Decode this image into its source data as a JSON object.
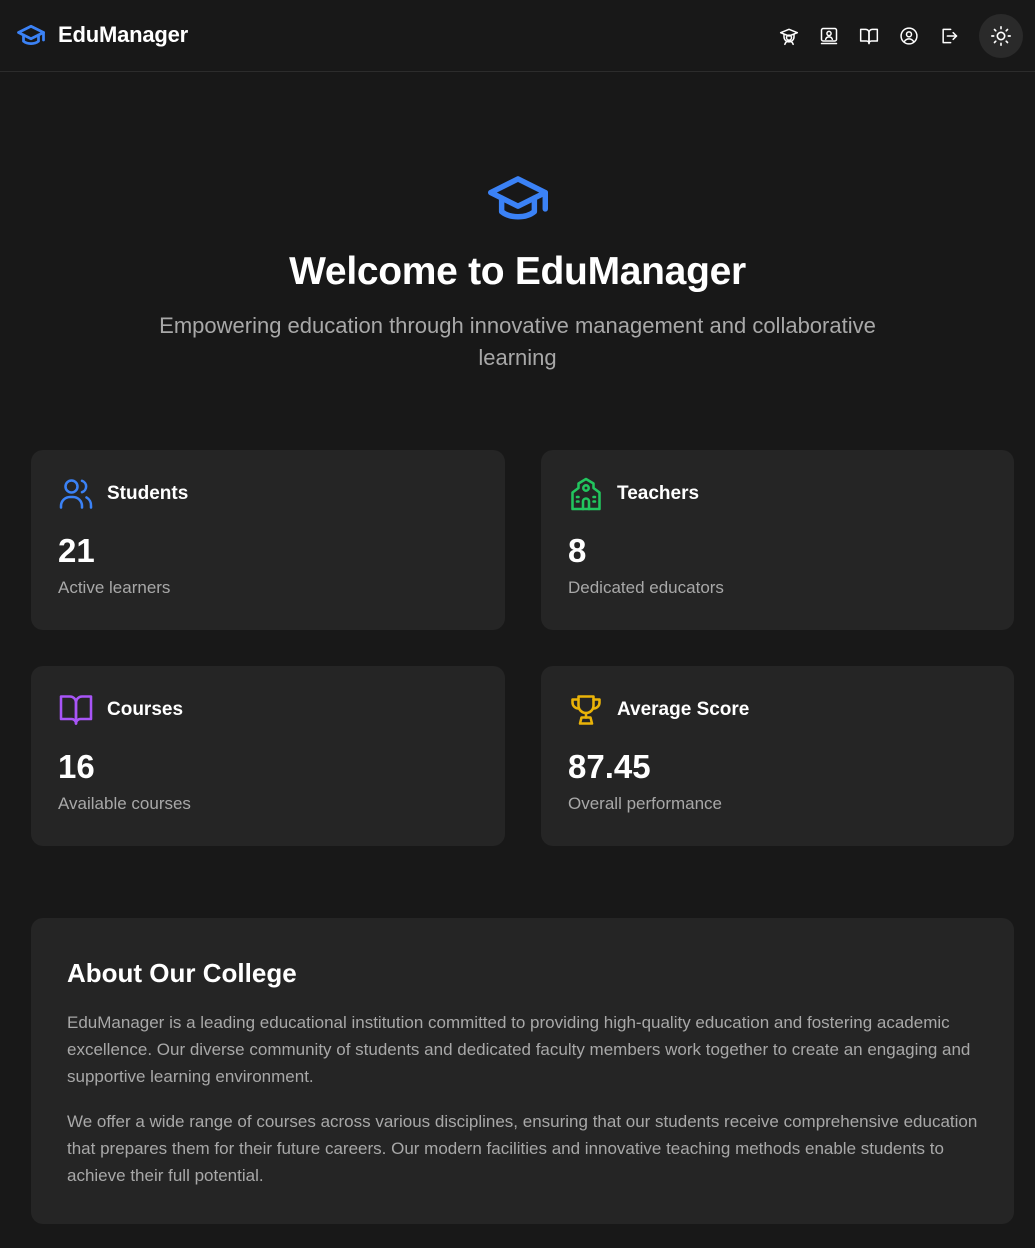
{
  "app": {
    "name": "EduManager"
  },
  "nav": {
    "icons": [
      "graduation-icon",
      "presentation-icon",
      "book-icon",
      "user-icon",
      "logout-icon",
      "sun-icon"
    ]
  },
  "hero": {
    "title": "Welcome to EduManager",
    "subtitle": "Empowering education through innovative management and collaborative learning"
  },
  "stats": [
    {
      "label": "Students",
      "value": "21",
      "desc": "Active learners",
      "icon": "users-icon",
      "color": "#3b82f6"
    },
    {
      "label": "Teachers",
      "value": "8",
      "desc": "Dedicated educators",
      "icon": "school-icon",
      "color": "#22c55e"
    },
    {
      "label": "Courses",
      "value": "16",
      "desc": "Available courses",
      "icon": "book-open-icon",
      "color": "#a855f7"
    },
    {
      "label": "Average Score",
      "value": "87.45",
      "desc": "Overall performance",
      "icon": "trophy-icon",
      "color": "#eab308"
    }
  ],
  "about": {
    "title": "About Our College",
    "paragraphs": [
      "EduManager is a leading educational institution committed to providing high-quality education and fostering academic excellence. Our diverse community of students and dedicated faculty members work together to create an engaging and supportive learning environment.",
      "We offer a wide range of courses across various disciplines, ensuring that our students receive comprehensive education that prepares them for their future careers. Our modern facilities and innovative teaching methods enable students to achieve their full potential."
    ]
  },
  "colors": {
    "accent": "#3b82f6",
    "background": "#181818",
    "card": "#252525"
  }
}
